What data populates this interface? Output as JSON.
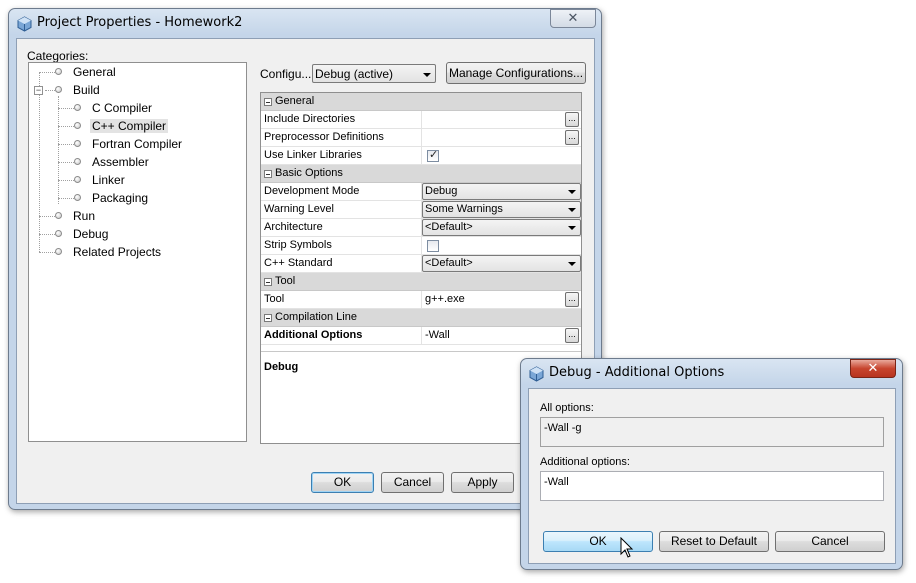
{
  "main_window": {
    "title": "Project Properties - Homework2",
    "close_glyph": "✕",
    "categories_label": "Categories:",
    "tree": [
      {
        "label": "General"
      },
      {
        "label": "Build",
        "expanded": true
      },
      {
        "label": "C Compiler"
      },
      {
        "label": "C++ Compiler",
        "selected": true
      },
      {
        "label": "Fortran Compiler"
      },
      {
        "label": "Assembler"
      },
      {
        "label": "Linker"
      },
      {
        "label": "Packaging"
      },
      {
        "label": "Run"
      },
      {
        "label": "Debug"
      },
      {
        "label": "Related Projects"
      }
    ],
    "config_label": "Configu...",
    "config_value": "Debug (active)",
    "manage_button": "Manage Configurations...",
    "sheet": {
      "general": "General",
      "include_dirs": "Include Directories",
      "preprocessor": "Preprocessor Definitions",
      "use_linker": "Use Linker Libraries",
      "use_linker_checked": true,
      "basic_options": "Basic Options",
      "dev_mode": "Development Mode",
      "dev_mode_value": "Debug",
      "warning_level": "Warning Level",
      "warning_level_value": "Some Warnings",
      "architecture": "Architecture",
      "architecture_value": "<Default>",
      "strip_symbols": "Strip Symbols",
      "strip_symbols_checked": false,
      "cpp_standard": "C++ Standard",
      "cpp_standard_value": "<Default>",
      "tool_cat": "Tool",
      "tool": "Tool",
      "tool_value": "g++.exe",
      "compilation_line": "Compilation Line",
      "additional_options": "Additional Options",
      "additional_options_value": "-Wall",
      "ellipsis": "...",
      "description_title": "Debug"
    },
    "ok_button": "OK",
    "cancel_button": "Cancel",
    "apply_button": "Apply"
  },
  "dialog": {
    "title": "Debug - Additional Options",
    "close_glyph": "✕",
    "all_options_label": "All options:",
    "all_options_value": "-Wall -g",
    "additional_label": "Additional options:",
    "additional_value": "-Wall",
    "ok_button": "OK",
    "reset_button": "Reset to Default",
    "cancel_button": "Cancel"
  }
}
